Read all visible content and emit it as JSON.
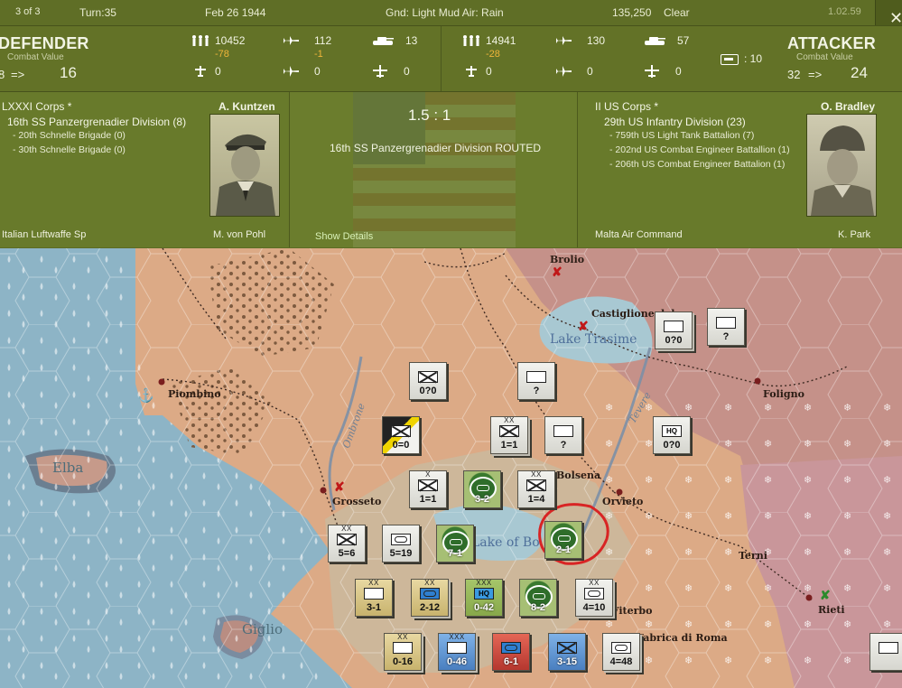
{
  "topbar": {
    "page": "3 of 3",
    "turn": "Turn:35",
    "date": "Feb 26 1944",
    "weather": "Gnd: Light Mud  Air: Rain",
    "score": "135,250",
    "weather2": "Clear",
    "version": "1.02.59",
    "close": "✕"
  },
  "defender": {
    "title": "DEFENDER",
    "subtitle": "Combat Value",
    "prev": "8",
    "arrow": "=>",
    "value": "16",
    "men": "10452",
    "men_loss": "-78",
    "air": "112",
    "air_loss": "-1",
    "tanks": "13",
    "gun1": "0",
    "plane2": "0",
    "plane3": "0",
    "corps": "LXXXI Corps *",
    "commander": "A. Kuntzen",
    "division": "16th SS Panzergrenadier Division (8)",
    "brigades": [
      "- 20th Schnelle Brigade (0)",
      "- 30th Schnelle Brigade (0)"
    ],
    "bottom_left": "Italian Luftwaffe Sp",
    "bottom_right": "M. von Pohl"
  },
  "attacker": {
    "title": "ATTACKER",
    "subtitle": "Combat Value",
    "prev": "32",
    "arrow": "=>",
    "value": "24",
    "men": "14941",
    "men_loss": "-28",
    "air": "130",
    "tanks": "57",
    "gun1": "0",
    "plane2": "0",
    "plane3": "0",
    "supply": ": 10",
    "corps": "II US Corps *",
    "commander": "O. Bradley",
    "division": "29th US Infantry Division (23)",
    "brigades": [
      "- 759th US Light Tank Battalion (7)",
      "- 202nd US Combat Engineer Battallion (1)",
      "- 206th US Combat Engineer Battalion (1)"
    ],
    "bottom_left": "Malta Air Command",
    "bottom_right": "K. Park"
  },
  "combat": {
    "odds": "1.5 : 1",
    "result": "16th SS Panzergrenadier Division ROUTED",
    "show_details": "Show Details"
  },
  "map": {
    "towns": [
      "Brolio",
      "Castiglione del",
      "Piombino",
      "Foligno",
      "Grosseto",
      "Orvieto",
      "Terni",
      "Rieti",
      "Viterbo",
      "Fabrica di Roma",
      "Bolsena"
    ],
    "islands": [
      "Elba",
      "Giglio"
    ],
    "lakes": [
      "Lake Trasime",
      "Lake of Bo"
    ],
    "rivers": [
      "Ombrone",
      "Tevere"
    ],
    "counters": [
      {
        "size": "",
        "str": "0?0"
      },
      {
        "size": "",
        "str": "?"
      },
      {
        "size": "",
        "str": "0?0"
      },
      {
        "size": "",
        "str": "?"
      },
      {
        "size": "",
        "str": "0=0"
      },
      {
        "size": "XX",
        "str": "1=1"
      },
      {
        "size": "",
        "str": "?"
      },
      {
        "size": "",
        "str": "0?0"
      },
      {
        "size": "X",
        "str": "1=1"
      },
      {
        "size": "",
        "str": "3-2"
      },
      {
        "size": "XX",
        "str": "1=4"
      },
      {
        "size": "XX",
        "str": "5=6"
      },
      {
        "size": "",
        "str": "5=19"
      },
      {
        "size": "",
        "str": "7-1"
      },
      {
        "size": "",
        "str": "2-1"
      },
      {
        "size": "XX",
        "str": "3-1"
      },
      {
        "size": "XX",
        "str": "2-12"
      },
      {
        "size": "XXX",
        "str": "0-42"
      },
      {
        "size": "",
        "str": "8-2"
      },
      {
        "size": "XX",
        "str": "4=10"
      },
      {
        "size": "XX",
        "str": "0-16"
      },
      {
        "size": "XXX",
        "str": "0-46"
      },
      {
        "size": "",
        "str": "6-1"
      },
      {
        "size": "",
        "str": "3-15"
      },
      {
        "size": "",
        "str": "4=48"
      },
      {
        "size": "",
        "str": "HQ"
      }
    ]
  },
  "colors": {
    "panel": "#687a2b",
    "header": "#637227",
    "loss": "#f0b53a",
    "sea": "#8fb7c7",
    "land": "#d9a583",
    "mountain": "#c48f8d",
    "lake": "#a9c7cf",
    "circle": "#d82424"
  },
  "icons": [
    "infantry-icon",
    "plane-icon",
    "tank-icon",
    "gun-icon",
    "bomber-icon",
    "close-icon",
    "supply-icon",
    "anchor-icon"
  ]
}
